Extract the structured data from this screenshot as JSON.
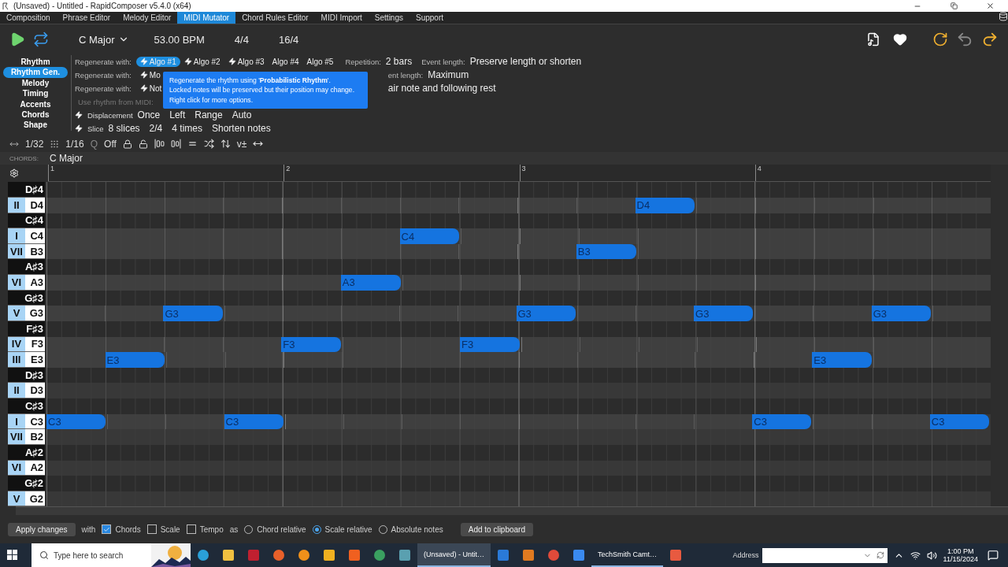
{
  "window": {
    "title": "(Unsaved) - Untitled - RapidComposer v5.4.0 (x64)"
  },
  "menu_tabs": [
    {
      "label": "Composition",
      "selected": false
    },
    {
      "label": "Phrase Editor",
      "selected": false
    },
    {
      "label": "Melody Editor",
      "selected": false
    },
    {
      "label": "MIDI Mutator",
      "selected": true
    },
    {
      "label": "Chord Rules Editor",
      "selected": false
    },
    {
      "label": "MIDI Import",
      "selected": false
    },
    {
      "label": "Settings",
      "selected": false
    },
    {
      "label": "Support",
      "selected": false
    }
  ],
  "toolbar": {
    "key": "C Major",
    "tempo": "53.00 BPM",
    "time_signature": "4/4",
    "length": "16/4"
  },
  "side_nav": [
    {
      "label": "Rhythm",
      "selected": false
    },
    {
      "label": "Rhythm Gen.",
      "selected": true
    },
    {
      "label": "Melody",
      "selected": false
    },
    {
      "label": "Timing",
      "selected": false
    },
    {
      "label": "Accents",
      "selected": false
    },
    {
      "label": "Chords",
      "selected": false
    },
    {
      "label": "Shape",
      "selected": false
    }
  ],
  "panel_rows": [
    {
      "kind": "regen",
      "label": "Regenerate with:",
      "algos": [
        {
          "label": "Algo #1",
          "bolt": true,
          "selected": true
        },
        {
          "label": "Algo #2",
          "bolt": true,
          "selected": false
        },
        {
          "label": "Algo #3",
          "bolt": true,
          "selected": false
        },
        {
          "label": "Algo #4",
          "bolt": false,
          "selected": false
        },
        {
          "label": "Algo #5",
          "bolt": false,
          "selected": false
        }
      ],
      "options": [
        {
          "label": "Repetition:",
          "value": "2 bars"
        },
        {
          "label": "Event length:",
          "value": "Preserve length or shorten"
        }
      ]
    },
    {
      "kind": "covered",
      "label": "Regenerate with:",
      "algos": [
        {
          "label": "Mo",
          "bolt": true,
          "selected": false
        }
      ],
      "options": [
        {
          "label": "ent length:",
          "value": "Maximum"
        }
      ]
    },
    {
      "kind": "covered",
      "label": "Regenerate with:",
      "algos": [
        {
          "label": "Not",
          "bolt": true,
          "selected": false
        }
      ],
      "options": [
        {
          "value": "air note and following rest"
        }
      ]
    },
    {
      "kind": "midi",
      "label": "Use rhythm from MIDI:",
      "disabled": true
    },
    {
      "kind": "action",
      "label": "Displacement",
      "values": [
        "Once",
        "Left",
        "Range",
        "Auto"
      ]
    },
    {
      "kind": "action",
      "label": "Slice",
      "values": [
        "8 slices",
        "2/4",
        "4 times",
        "Shorten notes"
      ]
    }
  ],
  "tooltip": {
    "lines": [
      "Regenerate the rhythm using '**Probabilistic Rhythm**'.",
      "Locked notes will be preserved but their position may change.",
      "Right click for more options."
    ]
  },
  "tool_strip": {
    "note_length": "1/32",
    "grid": "1/16",
    "quantize_label": "Q",
    "quantize": "Off",
    "velocity": "v±"
  },
  "chords_row": {
    "label": "CHORDS:",
    "value": "C Major"
  },
  "piano_roll": {
    "bars": [
      "1",
      "2",
      "3",
      "4"
    ],
    "rows": [
      {
        "note": "D♯4",
        "in_scale": false
      },
      {
        "note": "D4",
        "degree": "II",
        "in_scale": true,
        "notes": [
          {
            "on": false
          },
          {
            "on": false
          },
          {
            "on": false
          },
          {
            "on": false
          },
          {
            "on": false
          },
          {
            "on": false
          },
          {
            "on": false
          },
          {
            "on": false
          },
          {
            "on": false
          },
          {
            "on": false
          },
          {
            "on": true,
            "label": "D4"
          },
          {
            "on": false
          },
          {
            "on": false
          },
          {
            "on": false
          },
          {
            "on": false
          },
          {
            "on": false
          }
        ]
      },
      {
        "note": "C♯4",
        "in_scale": false
      },
      {
        "note": "C4",
        "degree": "I",
        "in_scale": true,
        "notes": [
          {
            "on": false
          },
          {
            "on": false
          },
          {
            "on": false
          },
          {
            "on": false
          },
          {
            "on": false
          },
          {
            "on": false
          },
          {
            "on": true,
            "label": "C4"
          },
          {
            "on": false
          },
          {
            "on": false
          },
          {
            "on": false
          },
          {
            "on": false
          },
          {
            "on": false
          },
          {
            "on": false
          },
          {
            "on": false
          },
          {
            "on": false
          },
          {
            "on": false
          }
        ]
      },
      {
        "note": "B3",
        "degree": "VII",
        "in_scale": true,
        "notes": [
          {
            "on": false
          },
          {
            "on": false
          },
          {
            "on": false
          },
          {
            "on": false
          },
          {
            "on": false
          },
          {
            "on": false
          },
          {
            "on": false
          },
          {
            "on": false
          },
          {
            "on": false
          },
          {
            "on": true,
            "label": "B3"
          },
          {
            "on": false
          },
          {
            "on": false
          },
          {
            "on": false
          },
          {
            "on": false
          },
          {
            "on": false
          },
          {
            "on": false
          }
        ]
      },
      {
        "note": "A♯3",
        "in_scale": false
      },
      {
        "note": "A3",
        "degree": "VI",
        "in_scale": true,
        "notes": [
          {
            "on": false
          },
          {
            "on": false
          },
          {
            "on": false
          },
          {
            "on": false
          },
          {
            "on": false
          },
          {
            "on": true,
            "label": "A3"
          },
          {
            "on": false
          },
          {
            "on": false
          },
          {
            "on": false
          },
          {
            "on": false
          },
          {
            "on": false
          },
          {
            "on": false
          },
          {
            "on": false
          },
          {
            "on": false
          },
          {
            "on": false
          },
          {
            "on": false
          }
        ]
      },
      {
        "note": "G♯3",
        "in_scale": false
      },
      {
        "note": "G3",
        "degree": "V",
        "in_scale": true,
        "notes": [
          {
            "on": false
          },
          {
            "on": false
          },
          {
            "on": true,
            "label": "G3"
          },
          {
            "on": false
          },
          {
            "on": false
          },
          {
            "on": false
          },
          {
            "on": false
          },
          {
            "on": false
          },
          {
            "on": true,
            "label": "G3"
          },
          {
            "on": false
          },
          {
            "on": false
          },
          {
            "on": true,
            "label": "G3"
          },
          {
            "on": false
          },
          {
            "on": false
          },
          {
            "on": true,
            "label": "G3"
          },
          {
            "on": false
          }
        ]
      },
      {
        "note": "F♯3",
        "in_scale": false
      },
      {
        "note": "F3",
        "degree": "IV",
        "in_scale": true,
        "notes": [
          {
            "on": false
          },
          {
            "on": false
          },
          {
            "on": false
          },
          {
            "on": false
          },
          {
            "on": true,
            "label": "F3"
          },
          {
            "on": false
          },
          {
            "on": false
          },
          {
            "on": true,
            "label": "F3"
          },
          {
            "on": false
          },
          {
            "on": false
          },
          {
            "on": false
          },
          {
            "on": false
          },
          {
            "on": false
          },
          {
            "on": false
          },
          {
            "on": false
          },
          {
            "on": false
          }
        ]
      },
      {
        "note": "E3",
        "degree": "III",
        "in_scale": true,
        "notes": [
          {
            "on": false
          },
          {
            "on": true,
            "label": "E3"
          },
          {
            "on": false
          },
          {
            "on": false
          },
          {
            "on": false
          },
          {
            "on": false
          },
          {
            "on": false
          },
          {
            "on": false
          },
          {
            "on": false
          },
          {
            "on": false
          },
          {
            "on": false
          },
          {
            "on": false
          },
          {
            "on": false
          },
          {
            "on": true,
            "label": "E3"
          },
          {
            "on": false
          },
          {
            "on": false
          }
        ]
      },
      {
        "note": "D♯3",
        "in_scale": false
      },
      {
        "note": "D3",
        "degree": "II",
        "in_scale": true
      },
      {
        "note": "C♯3",
        "in_scale": false
      },
      {
        "note": "C3",
        "degree": "I",
        "in_scale": true,
        "notes": [
          {
            "on": true,
            "label": "C3"
          },
          {
            "on": false
          },
          {
            "on": false
          },
          {
            "on": true,
            "label": "C3"
          },
          {
            "on": false
          },
          {
            "on": false
          },
          {
            "on": false
          },
          {
            "on": false
          },
          {
            "on": false
          },
          {
            "on": false
          },
          {
            "on": false
          },
          {
            "on": false
          },
          {
            "on": true,
            "label": "C3"
          },
          {
            "on": false
          },
          {
            "on": false
          },
          {
            "on": true,
            "label": "C3"
          }
        ]
      },
      {
        "note": "B2",
        "degree": "VII",
        "in_scale": true
      },
      {
        "note": "A♯2",
        "in_scale": false
      },
      {
        "note": "A2",
        "degree": "VI",
        "in_scale": true
      },
      {
        "note": "G♯2",
        "in_scale": false
      },
      {
        "note": "G2",
        "degree": "V",
        "in_scale": true
      }
    ]
  },
  "bottom_bar": {
    "apply": "Apply changes",
    "with": "with",
    "checks": [
      {
        "label": "Chords",
        "checked": true
      },
      {
        "label": "Scale",
        "checked": false
      },
      {
        "label": "Tempo",
        "checked": false
      }
    ],
    "as": "as",
    "radios": [
      {
        "label": "Chord relative",
        "selected": false
      },
      {
        "label": "Scale relative",
        "selected": true
      },
      {
        "label": "Absolute notes",
        "selected": false
      }
    ],
    "clipboard": "Add to clipboard"
  },
  "taskbar": {
    "search_placeholder": "Type here to search",
    "windows": [
      {
        "label": "(Unsaved) - Untit…",
        "selected": true
      },
      {
        "label": "TechSmith Camt…",
        "selected": false
      }
    ],
    "address_label": "Address",
    "time": "1:00 PM",
    "date": "11/15/2024"
  }
}
